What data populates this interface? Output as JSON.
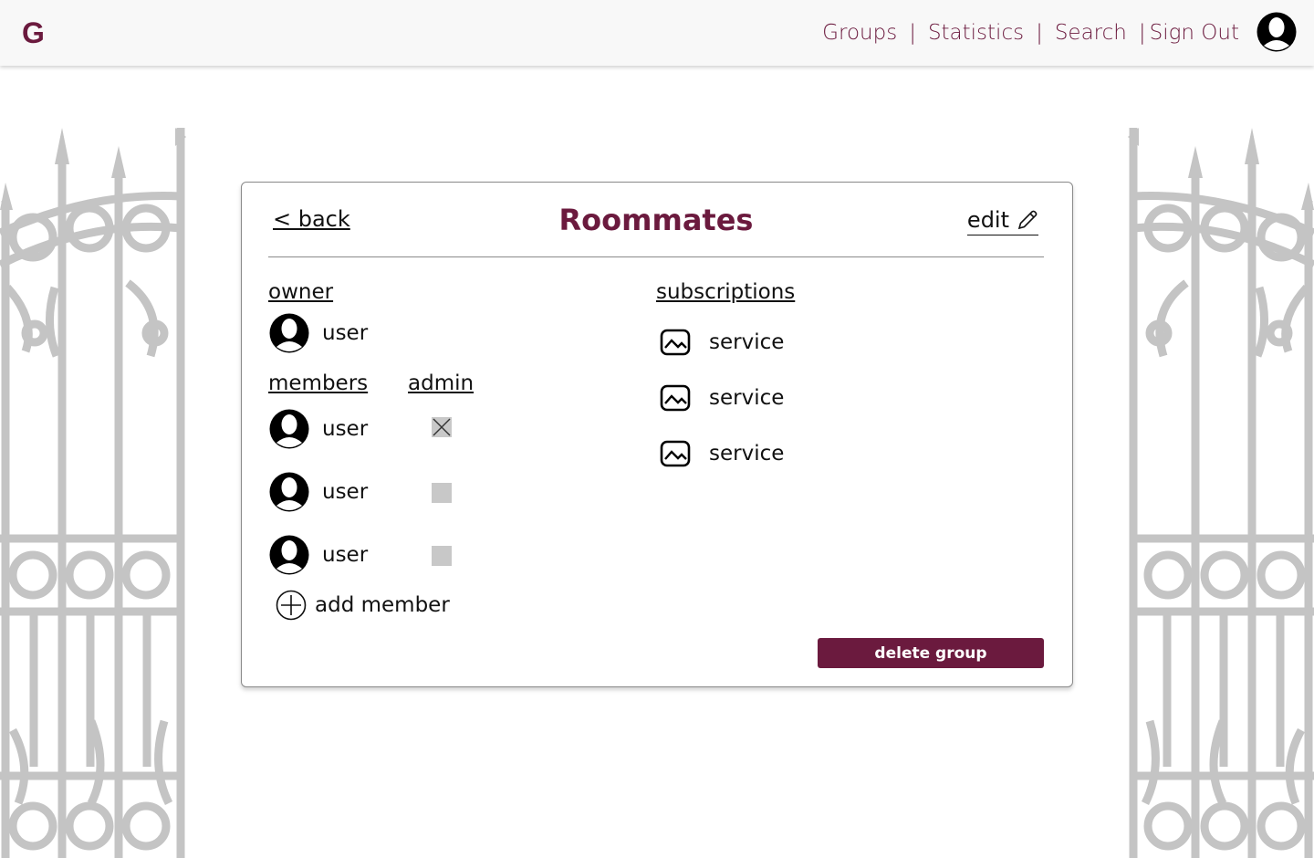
{
  "header": {
    "logo": "G",
    "nav": {
      "groups": "Groups",
      "statistics": "Statistics",
      "search": "Search",
      "sign_out": "Sign Out"
    },
    "separator": "|"
  },
  "group": {
    "back_label": "< back",
    "title": "Roommates",
    "edit_label": "edit"
  },
  "owner": {
    "label": "owner",
    "name": "user"
  },
  "members": {
    "label": "members",
    "admin_label": "admin",
    "items": [
      {
        "name": "user",
        "admin": true
      },
      {
        "name": "user",
        "admin": false
      },
      {
        "name": "user",
        "admin": false
      }
    ],
    "add_label": "add member"
  },
  "subscriptions": {
    "label": "subscriptions",
    "items": [
      {
        "name": "service",
        "icon": "image-icon"
      },
      {
        "name": "service",
        "icon": "image-icon"
      },
      {
        "name": "service",
        "icon": "image-icon"
      }
    ]
  },
  "actions": {
    "delete_label": "delete group"
  },
  "colors": {
    "brand": "#6b1a3e",
    "gate": "#c4c4c4",
    "checkbox": "#c8c8c8"
  }
}
